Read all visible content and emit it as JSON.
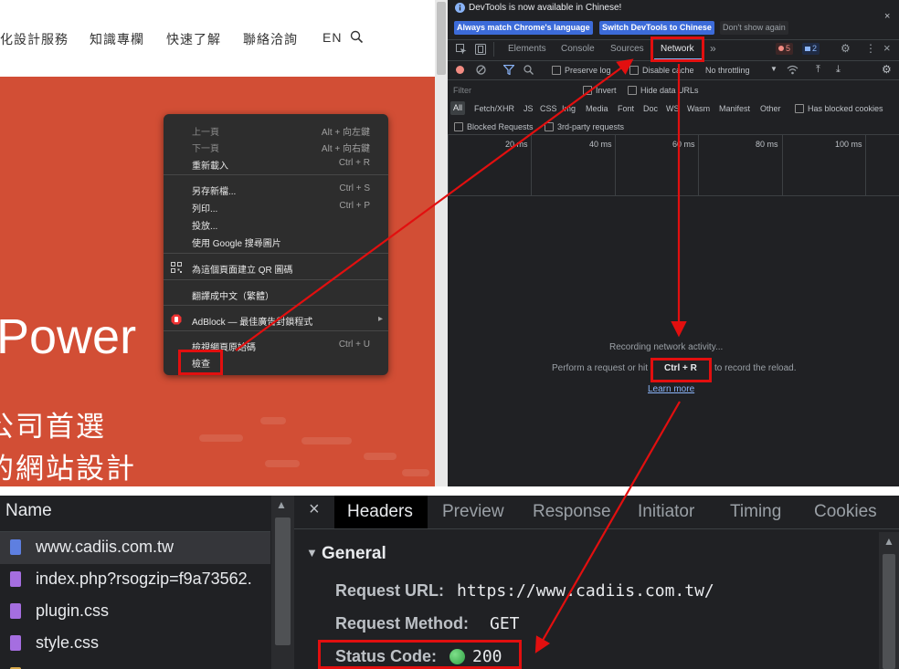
{
  "site": {
    "nav": [
      "化設計服務",
      "知識專欄",
      "快速了解",
      "聯絡洽詢",
      "EN"
    ],
    "hero_word": "Power",
    "hero_line1": "公司首選",
    "hero_line2": "的網站設計",
    "hero_color": "#d24e35"
  },
  "context_menu": {
    "items": [
      {
        "label": "上一頁",
        "shortcut": "Alt + 向左鍵"
      },
      {
        "label": "下一頁",
        "shortcut": "Alt + 向右鍵"
      },
      {
        "label": "重新載入",
        "shortcut": "Ctrl + R"
      },
      {
        "label": "另存新檔...",
        "shortcut": "Ctrl + S"
      },
      {
        "label": "列印...",
        "shortcut": "Ctrl + P"
      },
      {
        "label": "投放...",
        "shortcut": ""
      },
      {
        "label": "使用 Google 搜尋圖片",
        "shortcut": ""
      },
      {
        "label": "為這個頁面建立 QR 圖碼",
        "shortcut": ""
      },
      {
        "label": "翻譯成中文（繁體）",
        "shortcut": ""
      },
      {
        "label": "AdBlock — 最佳廣告封鎖程式",
        "shortcut": ""
      },
      {
        "label": "檢視網頁原始碼",
        "shortcut": "Ctrl + U"
      },
      {
        "label": "檢查",
        "shortcut": ""
      }
    ]
  },
  "devtools": {
    "banner": "DevTools is now available in Chinese!",
    "btn_match": "Always match Chrome's language",
    "btn_switch": "Switch DevTools to Chinese",
    "btn_dont": "Don't show again",
    "tabs": [
      "Elements",
      "Console",
      "Sources",
      "Network"
    ],
    "more": "»",
    "error_count": "5",
    "msg_count": "2",
    "preserve_log": "Preserve log",
    "disable_cache": "Disable cache",
    "throttling": "No throttling",
    "filter_placeholder": "Filter",
    "invert": "Invert",
    "hide_data_urls": "Hide data URLs",
    "types": [
      "All",
      "Fetch/XHR",
      "JS",
      "CSS",
      "Img",
      "Media",
      "Font",
      "Doc",
      "WS",
      "Wasm",
      "Manifest",
      "Other"
    ],
    "has_blocked_cookies": "Has blocked cookies",
    "blocked_requests": "Blocked Requests",
    "third_party": "3rd-party requests",
    "ticks": [
      "20 ms",
      "40 ms",
      "60 ms",
      "80 ms",
      "100 ms"
    ],
    "recording": "Recording network activity...",
    "perform_a": "Perform a request or hit",
    "shortcut": "Ctrl + R",
    "perform_b": "to record the reload.",
    "learn_more": "Learn more"
  },
  "bottom": {
    "name_header": "Name",
    "files": [
      {
        "name": "www.cadiis.com.tw",
        "color": "#5e7fe0"
      },
      {
        "name": "index.php?rsogzip=f9a73562.",
        "color": "#a56ee0"
      },
      {
        "name": "plugin.css",
        "color": "#a56ee0"
      },
      {
        "name": "style.css",
        "color": "#a56ee0"
      }
    ],
    "close": "×",
    "tabs": [
      "Headers",
      "Preview",
      "Response",
      "Initiator",
      "Timing",
      "Cookies"
    ],
    "section": "General",
    "request_url_label": "Request URL:",
    "request_url": "https://www.cadiis.com.tw/",
    "method_label": "Request Method:",
    "method": "GET",
    "status_label": "Status Code:",
    "status": "200"
  },
  "colors": {
    "highlight": "#e20f0f",
    "devtools_bg": "#202124",
    "status_ok": "#2ea043"
  }
}
